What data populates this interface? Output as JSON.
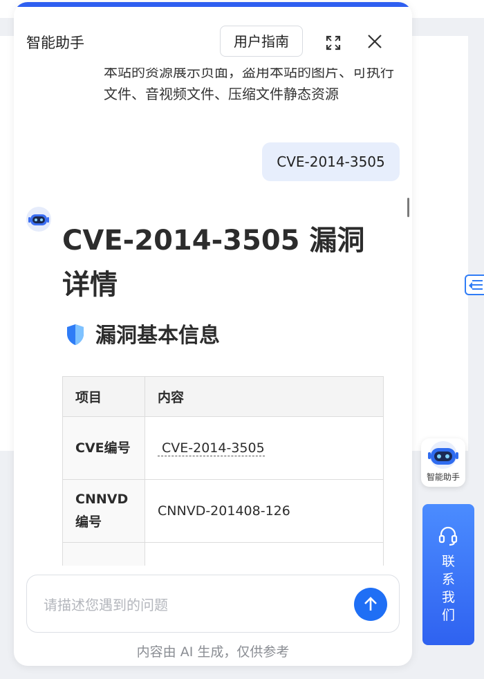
{
  "window": {
    "title": "智能助手",
    "guide_label": "用户指南"
  },
  "previous_message": {
    "text": "本站的资源展示页面，盗用本站的图片、可执行文件、音视频文件、压缩文件静态资源"
  },
  "user_message": {
    "text": "CVE-2014-3505"
  },
  "answer": {
    "title": "CVE-2014-3505 漏洞详情",
    "section_title": "漏洞基本信息",
    "table": {
      "headers": [
        "项目",
        "内容"
      ],
      "rows": [
        {
          "key": "CVE编号",
          "value": "CVE-2014-3505",
          "linked": true
        },
        {
          "key": "CNNVD编号",
          "value": "CNNVD-201408-126",
          "linked": false
        }
      ]
    }
  },
  "input": {
    "placeholder": "请描述您遇到的问题",
    "value": ""
  },
  "footer_note": "内容由 AI 生成，仅供参考",
  "side": {
    "assistant_label": "智能助手",
    "contact_label": "联系我们"
  },
  "colors": {
    "accent": "#1f6ff5",
    "bubble": "#e7eefc",
    "contact_gradient_top": "#4b8cff",
    "contact_gradient_bottom": "#2f62f0"
  }
}
